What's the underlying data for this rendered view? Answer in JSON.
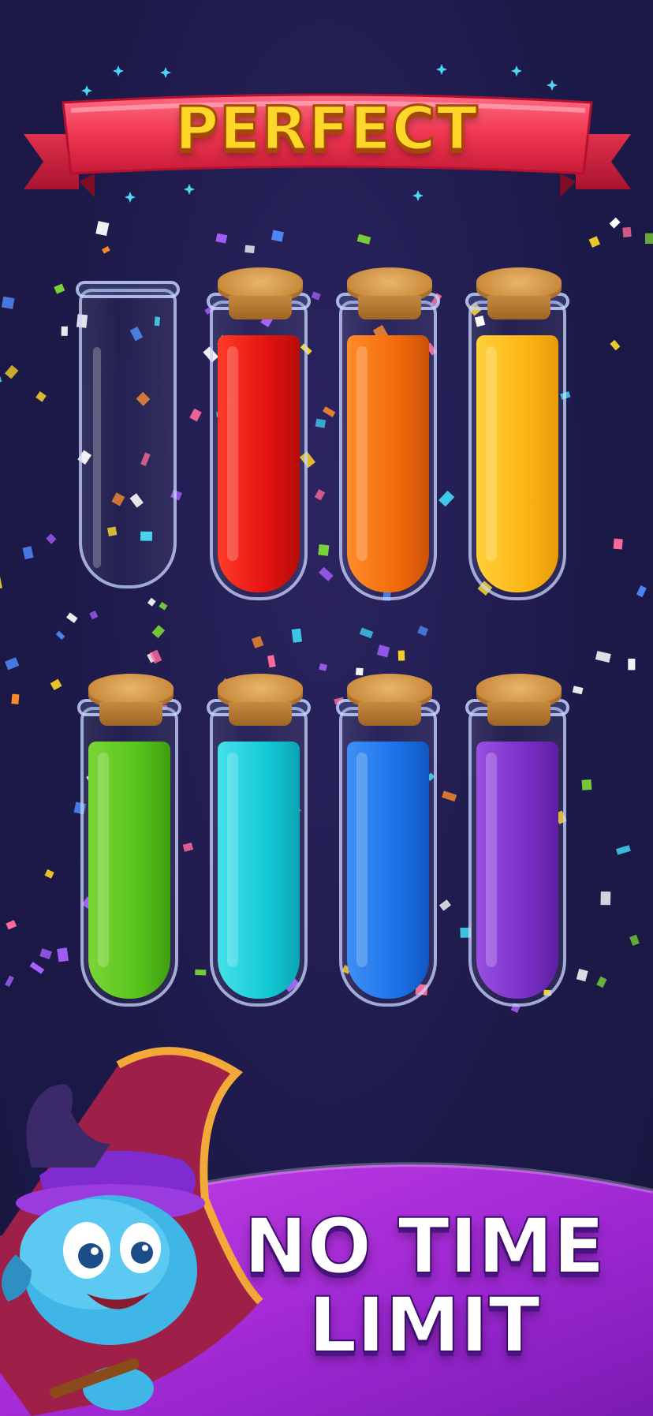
{
  "banner": {
    "text": "PERFECT"
  },
  "tubes": [
    {
      "id": "tube-1",
      "liquid": null,
      "corked": false
    },
    {
      "id": "tube-2",
      "liquid": "#e3130f",
      "corked": true
    },
    {
      "id": "tube-3",
      "liquid": "#f26b0b",
      "corked": true
    },
    {
      "id": "tube-4",
      "liquid": "#fdb514",
      "corked": true
    },
    {
      "id": "tube-5",
      "liquid": "#58c41c",
      "corked": true
    },
    {
      "id": "tube-6",
      "liquid": "#14cad7",
      "corked": true
    },
    {
      "id": "tube-7",
      "liquid": "#1a73e8",
      "corked": true
    },
    {
      "id": "tube-8",
      "liquid": "#7b2fc9",
      "corked": true
    }
  ],
  "tagline": {
    "line1": "NO TIME",
    "line2": "LIMIT"
  },
  "colors": {
    "background": "#1d1a4a",
    "ribbon": "#f23a5a",
    "banner_text": "#ffd728",
    "wave": "#a12bd6"
  },
  "icons": [
    "sparkle-icon",
    "confetti-icon",
    "cork-icon",
    "wizard-mascot-icon"
  ]
}
